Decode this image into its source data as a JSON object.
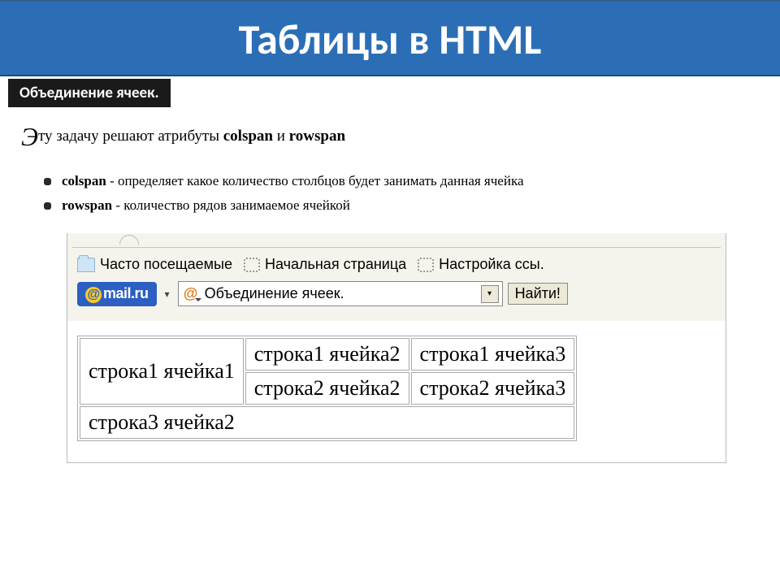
{
  "header": {
    "title": "Таблицы в HTML",
    "subtitle": "Объединение ячеек."
  },
  "intro": {
    "dropcap": "Э",
    "text_before": "ту задачу решают атрибуты ",
    "attr1": "colspan",
    "and": " и ",
    "attr2": "rowspan"
  },
  "bullets": [
    {
      "term": "colspan",
      "desc": " - определяет какое количество столбцов будет занимать данная ячейка"
    },
    {
      "term": "rowspan",
      "desc": " - количество рядов занимаемое ячейкой"
    }
  ],
  "browser": {
    "bookmarks": {
      "frequent": "Часто посещаемые",
      "start": "Начальная страница",
      "links": "Настройка ссы."
    },
    "logo": {
      "at": "@",
      "text": "mail.ru"
    },
    "search_text": "Объединение ячеек.",
    "search_button": "Найти!"
  },
  "table": {
    "r1c1": "строка1 ячейка1",
    "r1c2": "строка1 ячейка2",
    "r1c3": "строка1 ячейка3",
    "r2c2": "строка2 ячейка2",
    "r2c3": "строка2 ячейка3",
    "r3c2": "строка3 ячейка2"
  }
}
